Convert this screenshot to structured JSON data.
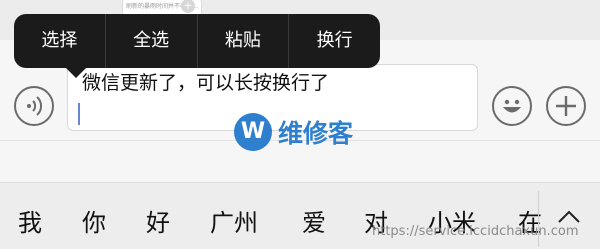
{
  "prev_message": {
    "snippet": "刷新的暴雨时间并不非常…"
  },
  "context_menu": {
    "items": [
      "选择",
      "全选",
      "粘贴",
      "换行"
    ]
  },
  "input": {
    "text": "微信更新了，可以长按换行了"
  },
  "watermark": {
    "logo_letter": "W",
    "brand": "维修客",
    "url": "https://service.iccidchaxun.com"
  },
  "keyboard": {
    "candidates": [
      "我",
      "你",
      "好",
      "广州",
      "爱",
      "对",
      "小米",
      "在"
    ]
  }
}
